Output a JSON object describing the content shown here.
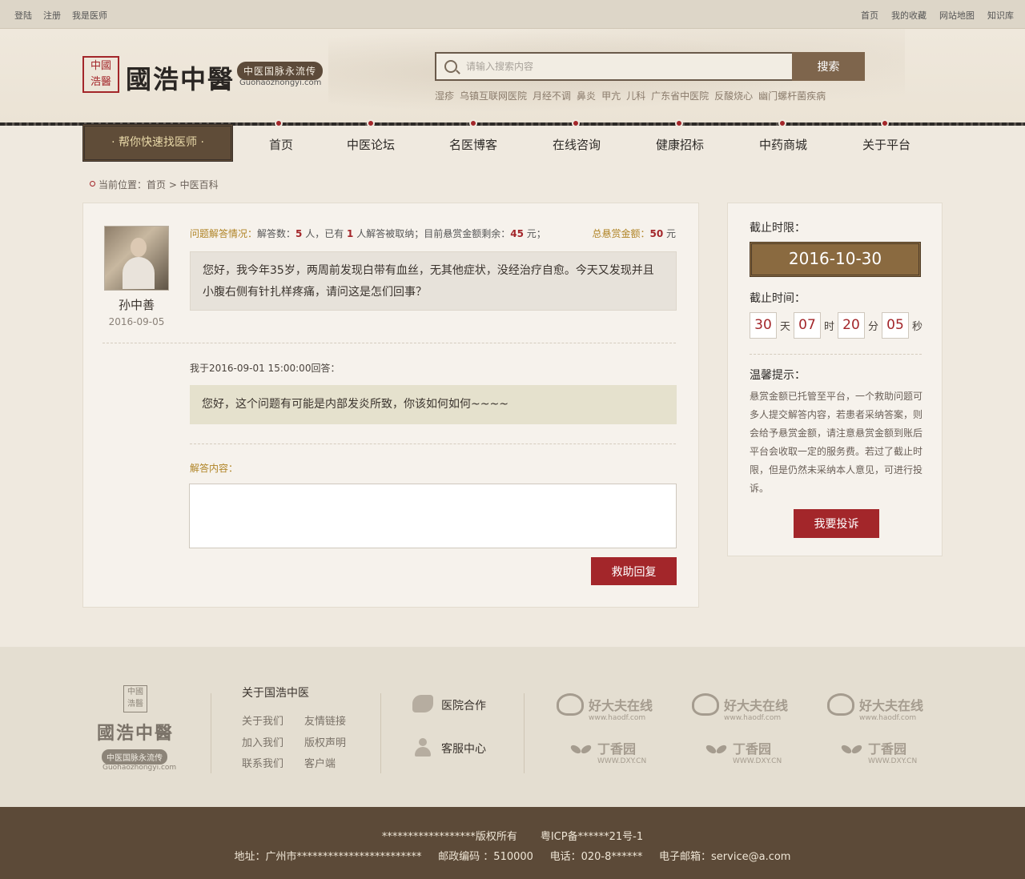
{
  "topbar": {
    "left": [
      "登陆",
      "注册",
      "我是医师"
    ],
    "right": [
      "首页",
      "我的收藏",
      "网站地图",
      "知识库"
    ]
  },
  "header": {
    "seal_text": [
      "中國",
      "浩醫"
    ],
    "brand": "國浩中醫",
    "tagline": "中医国脉永流传",
    "domain": "Guohaozhongyi.com",
    "search_placeholder": "请输入搜索内容",
    "search_button": "搜索",
    "hot_words": [
      "湿疹",
      "乌镇互联网医院",
      "月经不调",
      "鼻炎",
      "甲亢",
      "儿科",
      "广东省中医院",
      "反酸烧心",
      "幽门螺杆菌疾病"
    ]
  },
  "nav": {
    "find_doctor": "· 帮你快速找医师 ·",
    "items": [
      "首页",
      "中医论坛",
      "名医博客",
      "在线咨询",
      "健康招标",
      "中药商城",
      "关于平台"
    ]
  },
  "breadcrumb": "当前位置：首页 > 中医百科",
  "question": {
    "asker": "孙中善",
    "date": "2016-09-05",
    "status_label": "问题解答情况：",
    "answer_count_prefix": "解答数：",
    "answer_count": "5",
    "answer_count_suffix": " 人，已有 ",
    "accepted_count": "1",
    "accepted_suffix": " 人解答被取纳；目前悬赏金额剩余：",
    "remaining": "45",
    "remaining_unit": " 元；",
    "total_label": "总悬赏金额：",
    "total": "50",
    "total_unit": " 元",
    "text": "您好，我今年35岁，两周前发现白带有血丝，无其他症状，没经治疗自愈。今天又发现并且小腹右侧有针扎样疼痛，请问这是怎们回事？"
  },
  "answer": {
    "meta": "我于2016-09-01 15:00:00回答：",
    "text": "您好，这个问题有可能是内部发炎所致，你该如何如何~~~~",
    "label": "解答内容：",
    "input_value": "",
    "reply_button": "救助回复"
  },
  "side": {
    "deadline_label": "截止时限：",
    "deadline": "2016-10-30",
    "time_label": "截止时间：",
    "countdown": [
      {
        "value": "30",
        "unit": "天"
      },
      {
        "value": "07",
        "unit": "时"
      },
      {
        "value": "20",
        "unit": "分"
      },
      {
        "value": "05",
        "unit": "秒"
      }
    ],
    "tip_label": "温馨提示：",
    "tip": "悬赏金额已托管至平台，一个救助问题可多人提交解答内容，若患者采纳答案，则会给予悬赏金额，请注意悬赏金额到账后平台会收取一定的服务费。若过了截止时限，但是仍然未采纳本人意见，可进行投诉。",
    "complain_button": "我要投诉"
  },
  "footer": {
    "seal_text": [
      "中國",
      "浩醫"
    ],
    "brand": "國浩中醫",
    "tagline": "中医国脉永流传",
    "domain": "Guohaozhongyi.com",
    "about_title": "关于国浩中医",
    "links": [
      "关于我们",
      "友情链接",
      "加入我们",
      "版权声明",
      "联系我们",
      "客户端"
    ],
    "services": [
      "医院合作",
      "客服中心"
    ],
    "partner_a": "好大夫在线",
    "partner_a_sub": "www.haodf.com",
    "partner_b": "丁香园",
    "partner_b_sub": "WWW.DXY.CN",
    "copyright": "******************版权所有       粤ICP备******21号-1",
    "contact": "地址：广州市************************     邮政编码 ：510000     电话：020-8******     电子邮箱：service@a.com"
  }
}
